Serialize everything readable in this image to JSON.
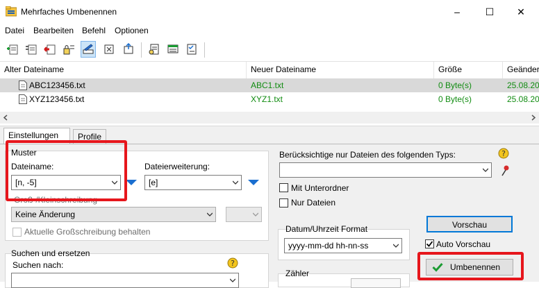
{
  "window": {
    "title": "Mehrfaches Umbenennen",
    "controls": [
      "–",
      "☐",
      "✕"
    ]
  },
  "menu": [
    "Datei",
    "Bearbeiten",
    "Befehl",
    "Optionen"
  ],
  "toolbar": {
    "icons": [
      "add-files-icon",
      "add-folder-icon",
      "remove-icon",
      "rename-rule-icon",
      "edit-pattern-icon",
      "lock-icon",
      "move-icon",
      "text-doc-icon",
      "preview-list-icon",
      "checklist-icon"
    ]
  },
  "filelist": {
    "columns": [
      "Alter Dateiname",
      "Neuer Dateiname",
      "Größe",
      "Geänder"
    ],
    "rows": [
      {
        "old": "ABC123456.txt",
        "new": "ABC1.txt",
        "size": "0 Byte(s)",
        "date": "25.08.20"
      },
      {
        "old": "XYZ123456.txt",
        "new": "XYZ1.txt",
        "size": "0 Byte(s)",
        "date": "25.08.20"
      }
    ]
  },
  "tabs": [
    "Einstellungen",
    "Profile"
  ],
  "muster": {
    "title": "Muster",
    "dateiname_label": "Dateiname:",
    "dateiname_value": "[n, -5]",
    "ext_label": "Dateierweiterung:",
    "ext_value": "[e]",
    "case_label": "Groß-/Kleinschreibung",
    "case_value": "Keine Änderung",
    "keep_case_label": "Aktuelle Großschreibung behalten"
  },
  "suchen": {
    "title": "Suchen und ersetzen",
    "search_label": "Suchen nach:"
  },
  "filter": {
    "label": "Berücksichtige nur Dateien des folgenden Typs:",
    "subfolder": "Mit Unterordner",
    "only_files": "Nur Dateien"
  },
  "datetime": {
    "label": "Datum/Uhrzeit Format",
    "value": "yyyy-mm-dd hh-nn-ss"
  },
  "counter": {
    "label": "Zähler"
  },
  "actions": {
    "preview": "Vorschau",
    "auto_preview": "Auto Vorschau",
    "rename": "Umbenennen"
  },
  "colors": {
    "highlight": "#e6161c",
    "green_text": "#118c11",
    "selected_row": "#d9d9d9"
  }
}
